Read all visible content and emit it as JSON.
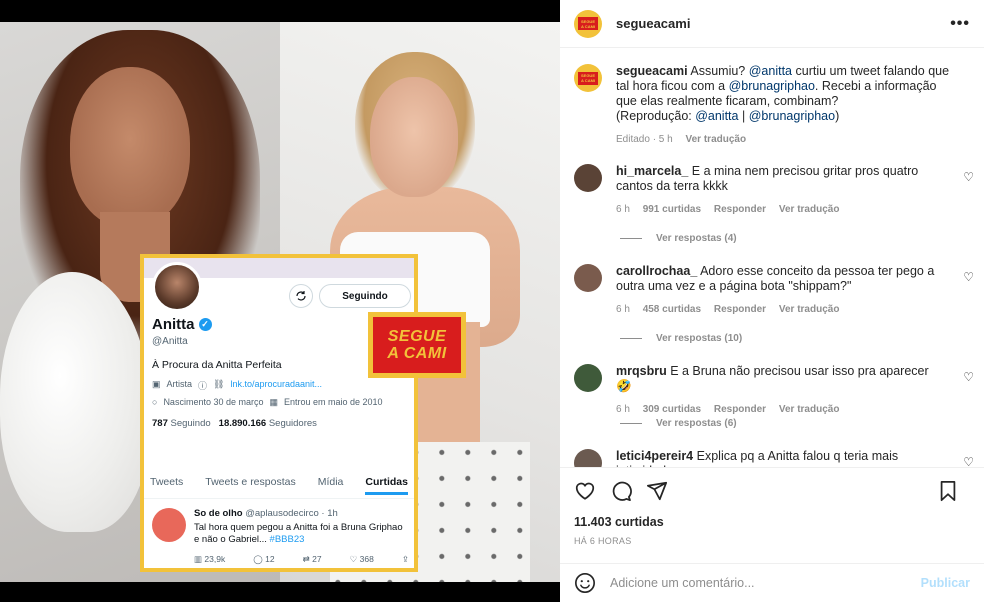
{
  "post": {
    "account": "segueacami",
    "logo_text_1": "SEGUE",
    "logo_text_2": "A CAMI",
    "caption": {
      "username": "segueacami",
      "text_1": "Assumiu? ",
      "mention_1": "@anitta",
      "text_2": " curtiu um tweet falando que tal hora ficou com a ",
      "mention_2": "@brunagriphao",
      "text_3": ". Recebi a informação que elas realmente ficaram, combinam?",
      "text_4": "(Reprodução: ",
      "mention_3": "@anitta",
      "text_5": " | ",
      "mention_4": "@brunagriphao",
      "text_6": ")",
      "edited": "Editado · 5 h",
      "translate": "Ver tradução"
    },
    "comments": [
      {
        "username": "hi_marcela_",
        "text": "E a mina nem precisou gritar pros quatro cantos da terra kkkk",
        "time": "6 h",
        "likes": "991 curtidas",
        "reply": "Responder",
        "translate": "Ver tradução",
        "replies": "Ver respostas (4)",
        "avatar_color": "#5a4336"
      },
      {
        "username": "carollrochaa_",
        "text": "Adoro esse conceito da pessoa ter pego a outra uma vez e a página bota \"shippam?\"",
        "time": "6 h",
        "likes": "458 curtidas",
        "reply": "Responder",
        "translate": "Ver tradução",
        "replies": "Ver respostas (10)",
        "avatar_color": "#7a5b4d"
      },
      {
        "username": "mrqsbru",
        "text": "E a Bruna não precisou usar isso pra aparecer 🤣",
        "time": "6 h",
        "likes": "309 curtidas",
        "reply": "Responder",
        "translate": "Ver tradução",
        "replies": "Ver respostas (6)",
        "avatar_color": "#3f5a3a"
      },
      {
        "username": "letici4pereir4",
        "text": "Explica pq a Anitta falou q teria mais intimidade",
        "avatar_color": "#6b5a50"
      }
    ],
    "likes_count": "11.403 curtidas",
    "time_ago": "HÁ 6 HORAS",
    "comment_placeholder": "Adicione um comentário...",
    "publish": "Publicar"
  },
  "tweet_card": {
    "follow_button": "Seguindo",
    "name": "Anitta",
    "handle": "@Anitta",
    "bio": "À Procura da Anitta Perfeita",
    "category": "Artista",
    "link": "lnk.to/aprocuradaanit...",
    "birth": "Nascimento 30 de março",
    "joined": "Entrou em maio de 2010",
    "following_count": "787",
    "following_label": "Seguindo",
    "followers_count": "18.890.166",
    "followers_label": "Seguidores",
    "tabs": [
      "Tweets",
      "Tweets e respostas",
      "Mídia",
      "Curtidas"
    ],
    "tweet": {
      "author": "So de olho",
      "handle_time": "@aplausodecirco · 1h",
      "text": "Tal hora quem pegou a Anitta foi a Bruna Griphao e não o Gabriel... ",
      "hashtag": "#BBB23",
      "views": "23,9k",
      "replies": "12",
      "retweets": "27",
      "likes": "368"
    }
  },
  "colors": {
    "brand_yellow": "#f2c23a",
    "brand_red": "#d81d1d",
    "twitter_blue": "#1d9bf0",
    "instagram_link": "#00376b"
  }
}
